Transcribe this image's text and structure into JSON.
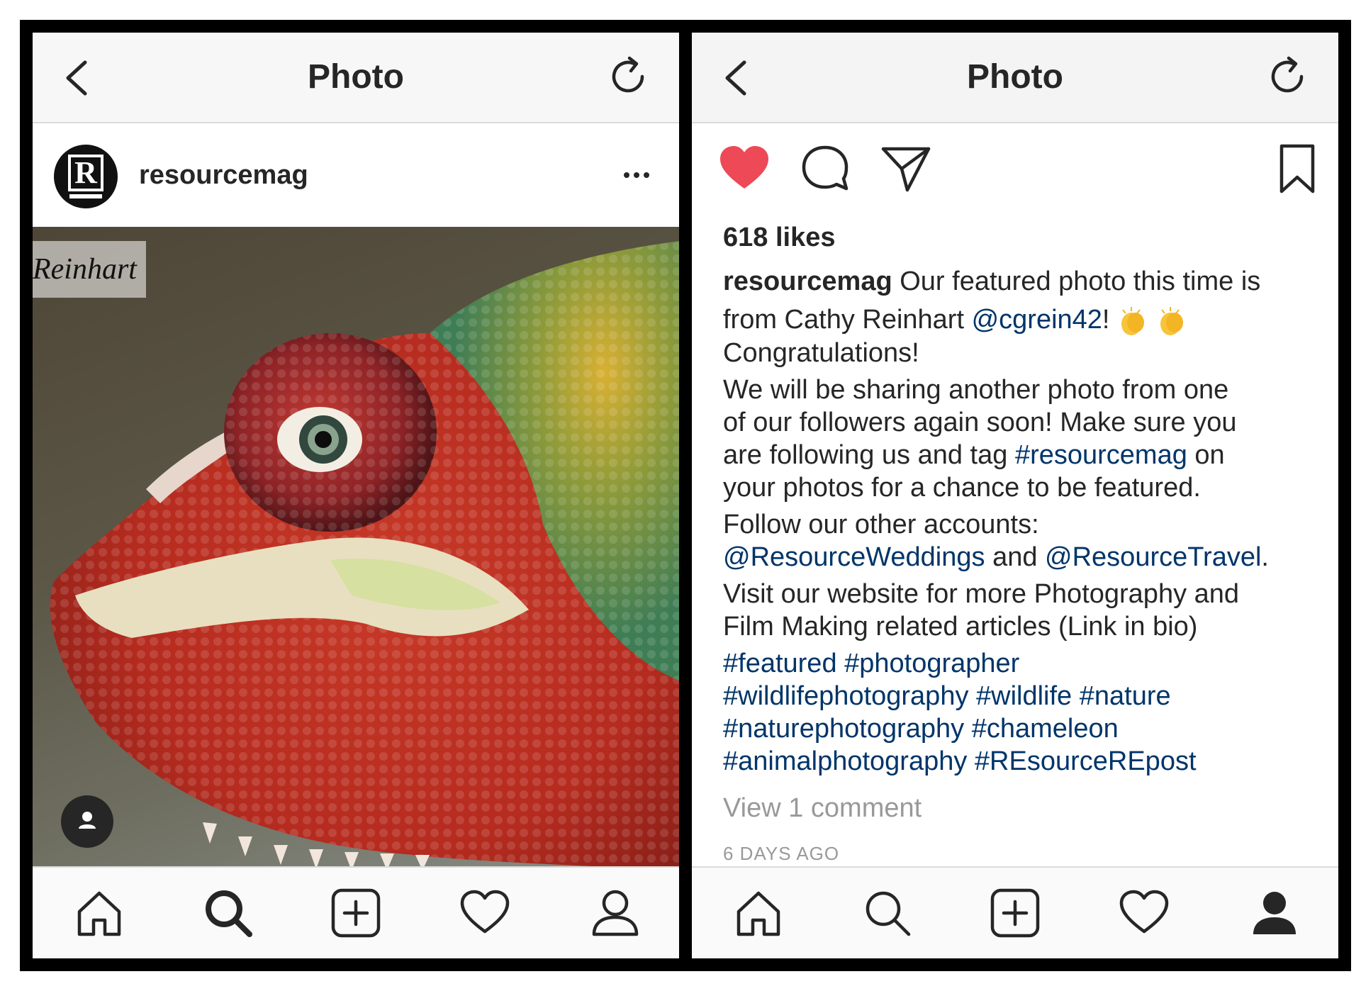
{
  "left": {
    "navbar": {
      "title": "Photo"
    },
    "post": {
      "username": "resourcemag",
      "avatar_letter": "R",
      "watermark": "Reinhart"
    },
    "tabbar": [
      "home-icon",
      "search-icon",
      "add-icon",
      "heart-icon",
      "profile-icon"
    ]
  },
  "right": {
    "navbar": {
      "title": "Photo"
    },
    "likes": "618 likes",
    "caption": {
      "username": "resourcemag",
      "line1": "Our featured photo this time is",
      "line2_text": "from Cathy Reinhart",
      "line2_mention": "@cgrein42",
      "line2_end": "!",
      "line3": "Congratulations!",
      "p2_l1": "We will be sharing another photo from one",
      "p2_l2": "of our followers again soon! Make sure you",
      "p2_l3_a": "are following us and tag",
      "p2_l3_tag": "#resourcemag",
      "p2_l3_b": "on",
      "p2_l4": "your photos for a chance to be featured.",
      "p3_l1": "Follow our other accounts:",
      "p3_m1": "@ResourceWeddings",
      "p3_and": "and",
      "p3_m2": "@ResourceTravel",
      "p3_dot": ".",
      "p4_l1": "Visit our website for more Photography and",
      "p4_l2": "Film Making related articles (Link in bio)",
      "tags_l1": "#featured #photographer",
      "tags_l2": "#wildlifephotography #wildlife #nature",
      "tags_l3": "#naturephotography #chameleon",
      "tags_l4": "#animalphotography #REsourceREpost"
    },
    "view_comments": "View 1 comment",
    "timestamp": "6 DAYS AGO",
    "colors": {
      "heart": "#ed4956",
      "link": "#003569"
    }
  }
}
